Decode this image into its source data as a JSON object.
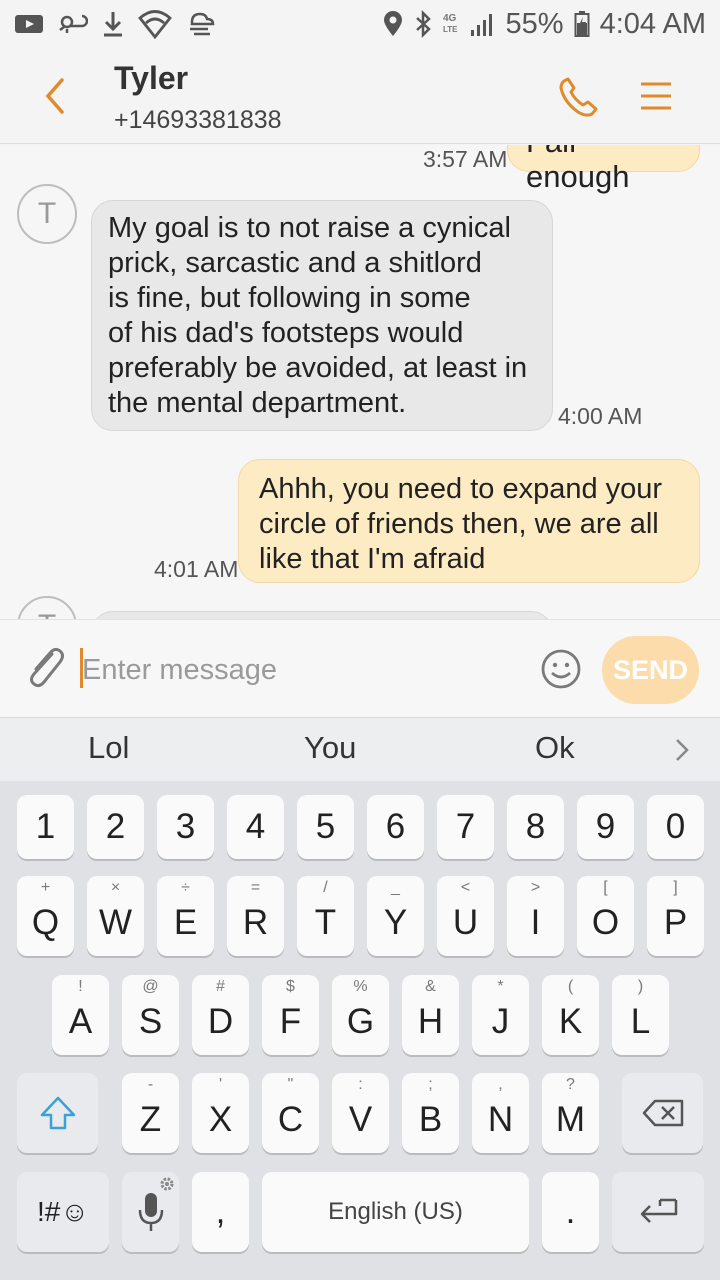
{
  "status_bar": {
    "battery_percent": "55%",
    "time": "4:04 AM",
    "icons": [
      "youtube-icon",
      "cloud-sync-icon",
      "download-icon",
      "wifi-shield-icon",
      "wind-icon",
      "location-icon",
      "bluetooth-icon",
      "4g-lte-icon",
      "signal-icon",
      "battery-icon"
    ]
  },
  "header": {
    "contact_name": "Tyler",
    "contact_number": "+14693381838",
    "icons": [
      "back-arrow-icon",
      "phone-icon",
      "menu-icon"
    ],
    "accent_color": "#e08a2c"
  },
  "conversation": {
    "messages": [
      {
        "direction": "out",
        "text": "Fair enough",
        "time": "3:57 AM"
      },
      {
        "direction": "in",
        "avatar": "T",
        "text_lines": [
          "My goal is to not raise a cynical",
          "prick, sarcastic and a shitlord",
          "is fine, but following in some",
          "of his dad's footsteps would",
          "preferably be avoided, at least in",
          "the mental department."
        ],
        "time": "4:00 AM"
      },
      {
        "direction": "out",
        "text_lines": [
          "Ahhh, you need to expand your",
          "circle of friends then, we are all",
          "like that I'm afraid"
        ],
        "time": "4:01 AM"
      },
      {
        "direction": "in",
        "avatar": "T",
        "text": ""
      }
    ]
  },
  "composer": {
    "placeholder": "Enter message",
    "send_label": "SEND"
  },
  "suggestions": {
    "items": [
      "Lol",
      "You",
      "Ok"
    ]
  },
  "keyboard": {
    "numbers": [
      "1",
      "2",
      "3",
      "4",
      "5",
      "6",
      "7",
      "8",
      "9",
      "0"
    ],
    "row1": [
      {
        "k": "Q",
        "s": "+"
      },
      {
        "k": "W",
        "s": "×"
      },
      {
        "k": "E",
        "s": "÷"
      },
      {
        "k": "R",
        "s": "="
      },
      {
        "k": "T",
        "s": "/"
      },
      {
        "k": "Y",
        "s": "_"
      },
      {
        "k": "U",
        "s": "<"
      },
      {
        "k": "I",
        "s": ">"
      },
      {
        "k": "O",
        "s": "["
      },
      {
        "k": "P",
        "s": "]"
      }
    ],
    "row2": [
      {
        "k": "A",
        "s": "!"
      },
      {
        "k": "S",
        "s": "@"
      },
      {
        "k": "D",
        "s": "#"
      },
      {
        "k": "F",
        "s": "$"
      },
      {
        "k": "G",
        "s": "%"
      },
      {
        "k": "H",
        "s": "&"
      },
      {
        "k": "J",
        "s": "*"
      },
      {
        "k": "K",
        "s": "("
      },
      {
        "k": "L",
        "s": ")"
      }
    ],
    "row3": [
      {
        "k": "Z",
        "s": "-"
      },
      {
        "k": "X",
        "s": "'"
      },
      {
        "k": "C",
        "s": "\""
      },
      {
        "k": "V",
        "s": ":"
      },
      {
        "k": "B",
        "s": ";"
      },
      {
        "k": "N",
        "s": ","
      },
      {
        "k": "M",
        "s": "?"
      }
    ],
    "symbols_label": "!#☺",
    "comma_label": ",",
    "space_label": "English (US)",
    "period_label": "."
  }
}
